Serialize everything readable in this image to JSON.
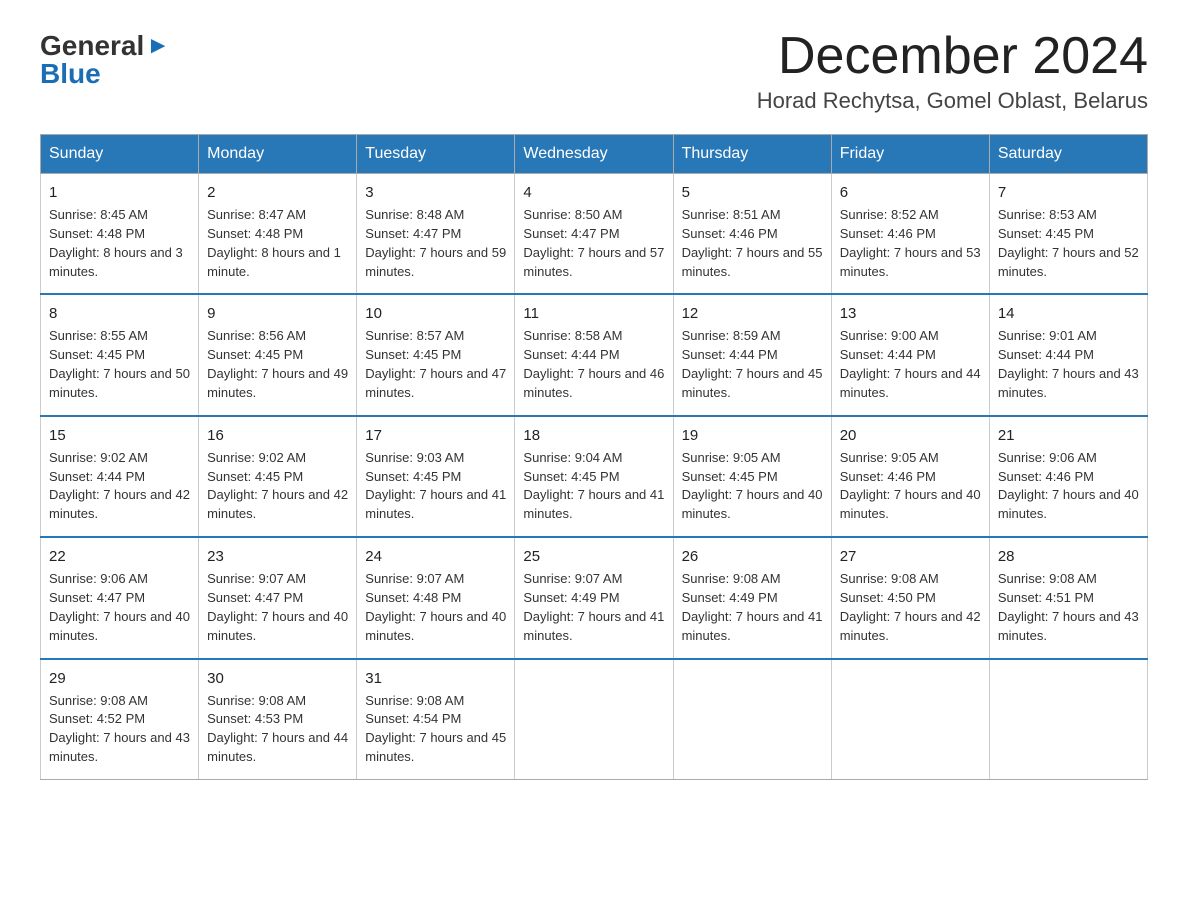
{
  "header": {
    "logo_general": "General",
    "logo_arrow": "▶",
    "logo_blue": "Blue",
    "month_title": "December 2024",
    "location": "Horad Rechytsa, Gomel Oblast, Belarus"
  },
  "weekdays": [
    "Sunday",
    "Monday",
    "Tuesday",
    "Wednesday",
    "Thursday",
    "Friday",
    "Saturday"
  ],
  "weeks": [
    [
      {
        "day": "1",
        "sunrise": "8:45 AM",
        "sunset": "4:48 PM",
        "daylight": "8 hours and 3 minutes."
      },
      {
        "day": "2",
        "sunrise": "8:47 AM",
        "sunset": "4:48 PM",
        "daylight": "8 hours and 1 minute."
      },
      {
        "day": "3",
        "sunrise": "8:48 AM",
        "sunset": "4:47 PM",
        "daylight": "7 hours and 59 minutes."
      },
      {
        "day": "4",
        "sunrise": "8:50 AM",
        "sunset": "4:47 PM",
        "daylight": "7 hours and 57 minutes."
      },
      {
        "day": "5",
        "sunrise": "8:51 AM",
        "sunset": "4:46 PM",
        "daylight": "7 hours and 55 minutes."
      },
      {
        "day": "6",
        "sunrise": "8:52 AM",
        "sunset": "4:46 PM",
        "daylight": "7 hours and 53 minutes."
      },
      {
        "day": "7",
        "sunrise": "8:53 AM",
        "sunset": "4:45 PM",
        "daylight": "7 hours and 52 minutes."
      }
    ],
    [
      {
        "day": "8",
        "sunrise": "8:55 AM",
        "sunset": "4:45 PM",
        "daylight": "7 hours and 50 minutes."
      },
      {
        "day": "9",
        "sunrise": "8:56 AM",
        "sunset": "4:45 PM",
        "daylight": "7 hours and 49 minutes."
      },
      {
        "day": "10",
        "sunrise": "8:57 AM",
        "sunset": "4:45 PM",
        "daylight": "7 hours and 47 minutes."
      },
      {
        "day": "11",
        "sunrise": "8:58 AM",
        "sunset": "4:44 PM",
        "daylight": "7 hours and 46 minutes."
      },
      {
        "day": "12",
        "sunrise": "8:59 AM",
        "sunset": "4:44 PM",
        "daylight": "7 hours and 45 minutes."
      },
      {
        "day": "13",
        "sunrise": "9:00 AM",
        "sunset": "4:44 PM",
        "daylight": "7 hours and 44 minutes."
      },
      {
        "day": "14",
        "sunrise": "9:01 AM",
        "sunset": "4:44 PM",
        "daylight": "7 hours and 43 minutes."
      }
    ],
    [
      {
        "day": "15",
        "sunrise": "9:02 AM",
        "sunset": "4:44 PM",
        "daylight": "7 hours and 42 minutes."
      },
      {
        "day": "16",
        "sunrise": "9:02 AM",
        "sunset": "4:45 PM",
        "daylight": "7 hours and 42 minutes."
      },
      {
        "day": "17",
        "sunrise": "9:03 AM",
        "sunset": "4:45 PM",
        "daylight": "7 hours and 41 minutes."
      },
      {
        "day": "18",
        "sunrise": "9:04 AM",
        "sunset": "4:45 PM",
        "daylight": "7 hours and 41 minutes."
      },
      {
        "day": "19",
        "sunrise": "9:05 AM",
        "sunset": "4:45 PM",
        "daylight": "7 hours and 40 minutes."
      },
      {
        "day": "20",
        "sunrise": "9:05 AM",
        "sunset": "4:46 PM",
        "daylight": "7 hours and 40 minutes."
      },
      {
        "day": "21",
        "sunrise": "9:06 AM",
        "sunset": "4:46 PM",
        "daylight": "7 hours and 40 minutes."
      }
    ],
    [
      {
        "day": "22",
        "sunrise": "9:06 AM",
        "sunset": "4:47 PM",
        "daylight": "7 hours and 40 minutes."
      },
      {
        "day": "23",
        "sunrise": "9:07 AM",
        "sunset": "4:47 PM",
        "daylight": "7 hours and 40 minutes."
      },
      {
        "day": "24",
        "sunrise": "9:07 AM",
        "sunset": "4:48 PM",
        "daylight": "7 hours and 40 minutes."
      },
      {
        "day": "25",
        "sunrise": "9:07 AM",
        "sunset": "4:49 PM",
        "daylight": "7 hours and 41 minutes."
      },
      {
        "day": "26",
        "sunrise": "9:08 AM",
        "sunset": "4:49 PM",
        "daylight": "7 hours and 41 minutes."
      },
      {
        "day": "27",
        "sunrise": "9:08 AM",
        "sunset": "4:50 PM",
        "daylight": "7 hours and 42 minutes."
      },
      {
        "day": "28",
        "sunrise": "9:08 AM",
        "sunset": "4:51 PM",
        "daylight": "7 hours and 43 minutes."
      }
    ],
    [
      {
        "day": "29",
        "sunrise": "9:08 AM",
        "sunset": "4:52 PM",
        "daylight": "7 hours and 43 minutes."
      },
      {
        "day": "30",
        "sunrise": "9:08 AM",
        "sunset": "4:53 PM",
        "daylight": "7 hours and 44 minutes."
      },
      {
        "day": "31",
        "sunrise": "9:08 AM",
        "sunset": "4:54 PM",
        "daylight": "7 hours and 45 minutes."
      },
      null,
      null,
      null,
      null
    ]
  ],
  "labels": {
    "sunrise": "Sunrise:",
    "sunset": "Sunset:",
    "daylight": "Daylight:"
  }
}
